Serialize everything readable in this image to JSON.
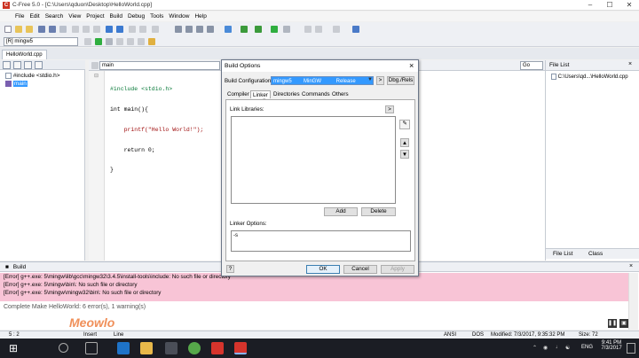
{
  "window": {
    "title": "C-Free 5.0 - [C:\\Users\\qduon\\Desktop\\HelloWorld.cpp]",
    "minimize": "–",
    "maximize": "☐",
    "close": "✕"
  },
  "menu": [
    "File",
    "Edit",
    "Search",
    "View",
    "Project",
    "Build",
    "Debug",
    "Tools",
    "Window",
    "Help"
  ],
  "toolbar": {
    "compiler_profile": "[R] mingw5",
    "function_combo": "main",
    "go_button": "Go"
  },
  "doc_tab": "HelloWorld.cpp",
  "left_panel": {
    "include_node": "#include <stdio.h>",
    "main_node": "main"
  },
  "editor": {
    "code_lines": [
      "#include <stdio.h>",
      "int main(){",
      "    printf(\"Hello World!\");",
      "    return 0;",
      "}"
    ]
  },
  "file_list": {
    "header": "File List",
    "item": "C:\\Users\\qd...\\HelloWorld.cpp",
    "tab_file_list": "File List",
    "tab_class": "Class"
  },
  "build_panel": {
    "header": "Build",
    "lines": [
      "[Error] g++.exe: 5\\mingw\\lib\\gcc\\mingw32\\3.4.5\\install-tools\\include: No such file or directory",
      "[Error] g++.exe: 5\\mingw\\bin\\: No such file or directory",
      "[Error] g++.exe: 5\\mingw\\mingw32\\bin\\: No such file or directory"
    ],
    "summary": "Complete Make HelloWorld: 6 error(s), 1 warning(s)"
  },
  "status_bar": {
    "position": "5 : 2",
    "mode": "Insert",
    "line_label": "Line",
    "encoding": "ANSI",
    "line_ending": "DOS",
    "modified": "Modified: 7/3/2017, 9:35:32 PM",
    "size": "Size: 72"
  },
  "watermark": "Meowlo",
  "dialog": {
    "title": "Build Options",
    "build_config_label": "Build Configuration:",
    "build_config_value": "mingw5        MinGW          Release",
    "arrow_button": ">",
    "dbg_rels_button": "Dbg./Rels",
    "tabs": [
      "Compiler",
      "Linker",
      "Directories",
      "Commands",
      "Others"
    ],
    "active_tab": "Linker",
    "link_libraries_label": "Link Libraries:",
    "more_button": ">",
    "add_button": "Add",
    "delete_button": "Delete",
    "linker_options_label": "Linker Options:",
    "linker_options_value": "-s",
    "help_button": "?",
    "ok_button": "OK",
    "cancel_button": "Cancel",
    "apply_button": "Apply"
  },
  "taskbar": {
    "language": "ENG",
    "time": "9:41 PM",
    "date": "7/3/2017"
  },
  "colors": {
    "selection": "#3399ff",
    "error_background": "#f8c4d6",
    "taskbar": "#1b1d24"
  }
}
